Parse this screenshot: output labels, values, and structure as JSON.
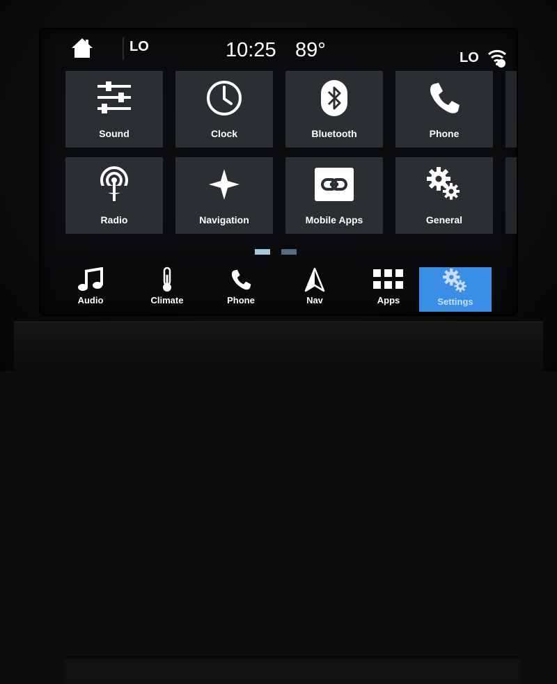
{
  "status": {
    "lo_left": "LO",
    "time": "10:25",
    "temperature": "89°",
    "lo_right": "LO",
    "wifi_icon": "wifi-icon",
    "home_icon": "home-icon"
  },
  "grid": [
    {
      "label": "Sound",
      "icon": "sliders-icon"
    },
    {
      "label": "Clock",
      "icon": "clock-icon"
    },
    {
      "label": "Bluetooth",
      "icon": "bluetooth-icon"
    },
    {
      "label": "Phone",
      "icon": "phone-icon"
    },
    {
      "label": "Radio",
      "icon": "radio-icon"
    },
    {
      "label": "Navigation",
      "icon": "star-navigation-icon"
    },
    {
      "label": "Mobile Apps",
      "icon": "link-icon"
    },
    {
      "label": "General",
      "icon": "gears-icon"
    }
  ],
  "pager": {
    "pages": 2,
    "current": 1
  },
  "dock": [
    {
      "label": "Audio",
      "icon": "music-note-icon"
    },
    {
      "label": "Climate",
      "icon": "thermometer-icon"
    },
    {
      "label": "Phone",
      "icon": "phone-icon"
    },
    {
      "label": "Nav",
      "icon": "navigation-arrow-icon"
    },
    {
      "label": "Apps",
      "icon": "grid-apps-icon"
    },
    {
      "label": "Settings",
      "icon": "gears-icon",
      "active": true
    }
  ],
  "colors": {
    "tile_bg": "#2b2e33",
    "active_dock": "#3b8ee6",
    "pager_active": "#a9c6df",
    "pager_inactive": "#556b7e"
  }
}
